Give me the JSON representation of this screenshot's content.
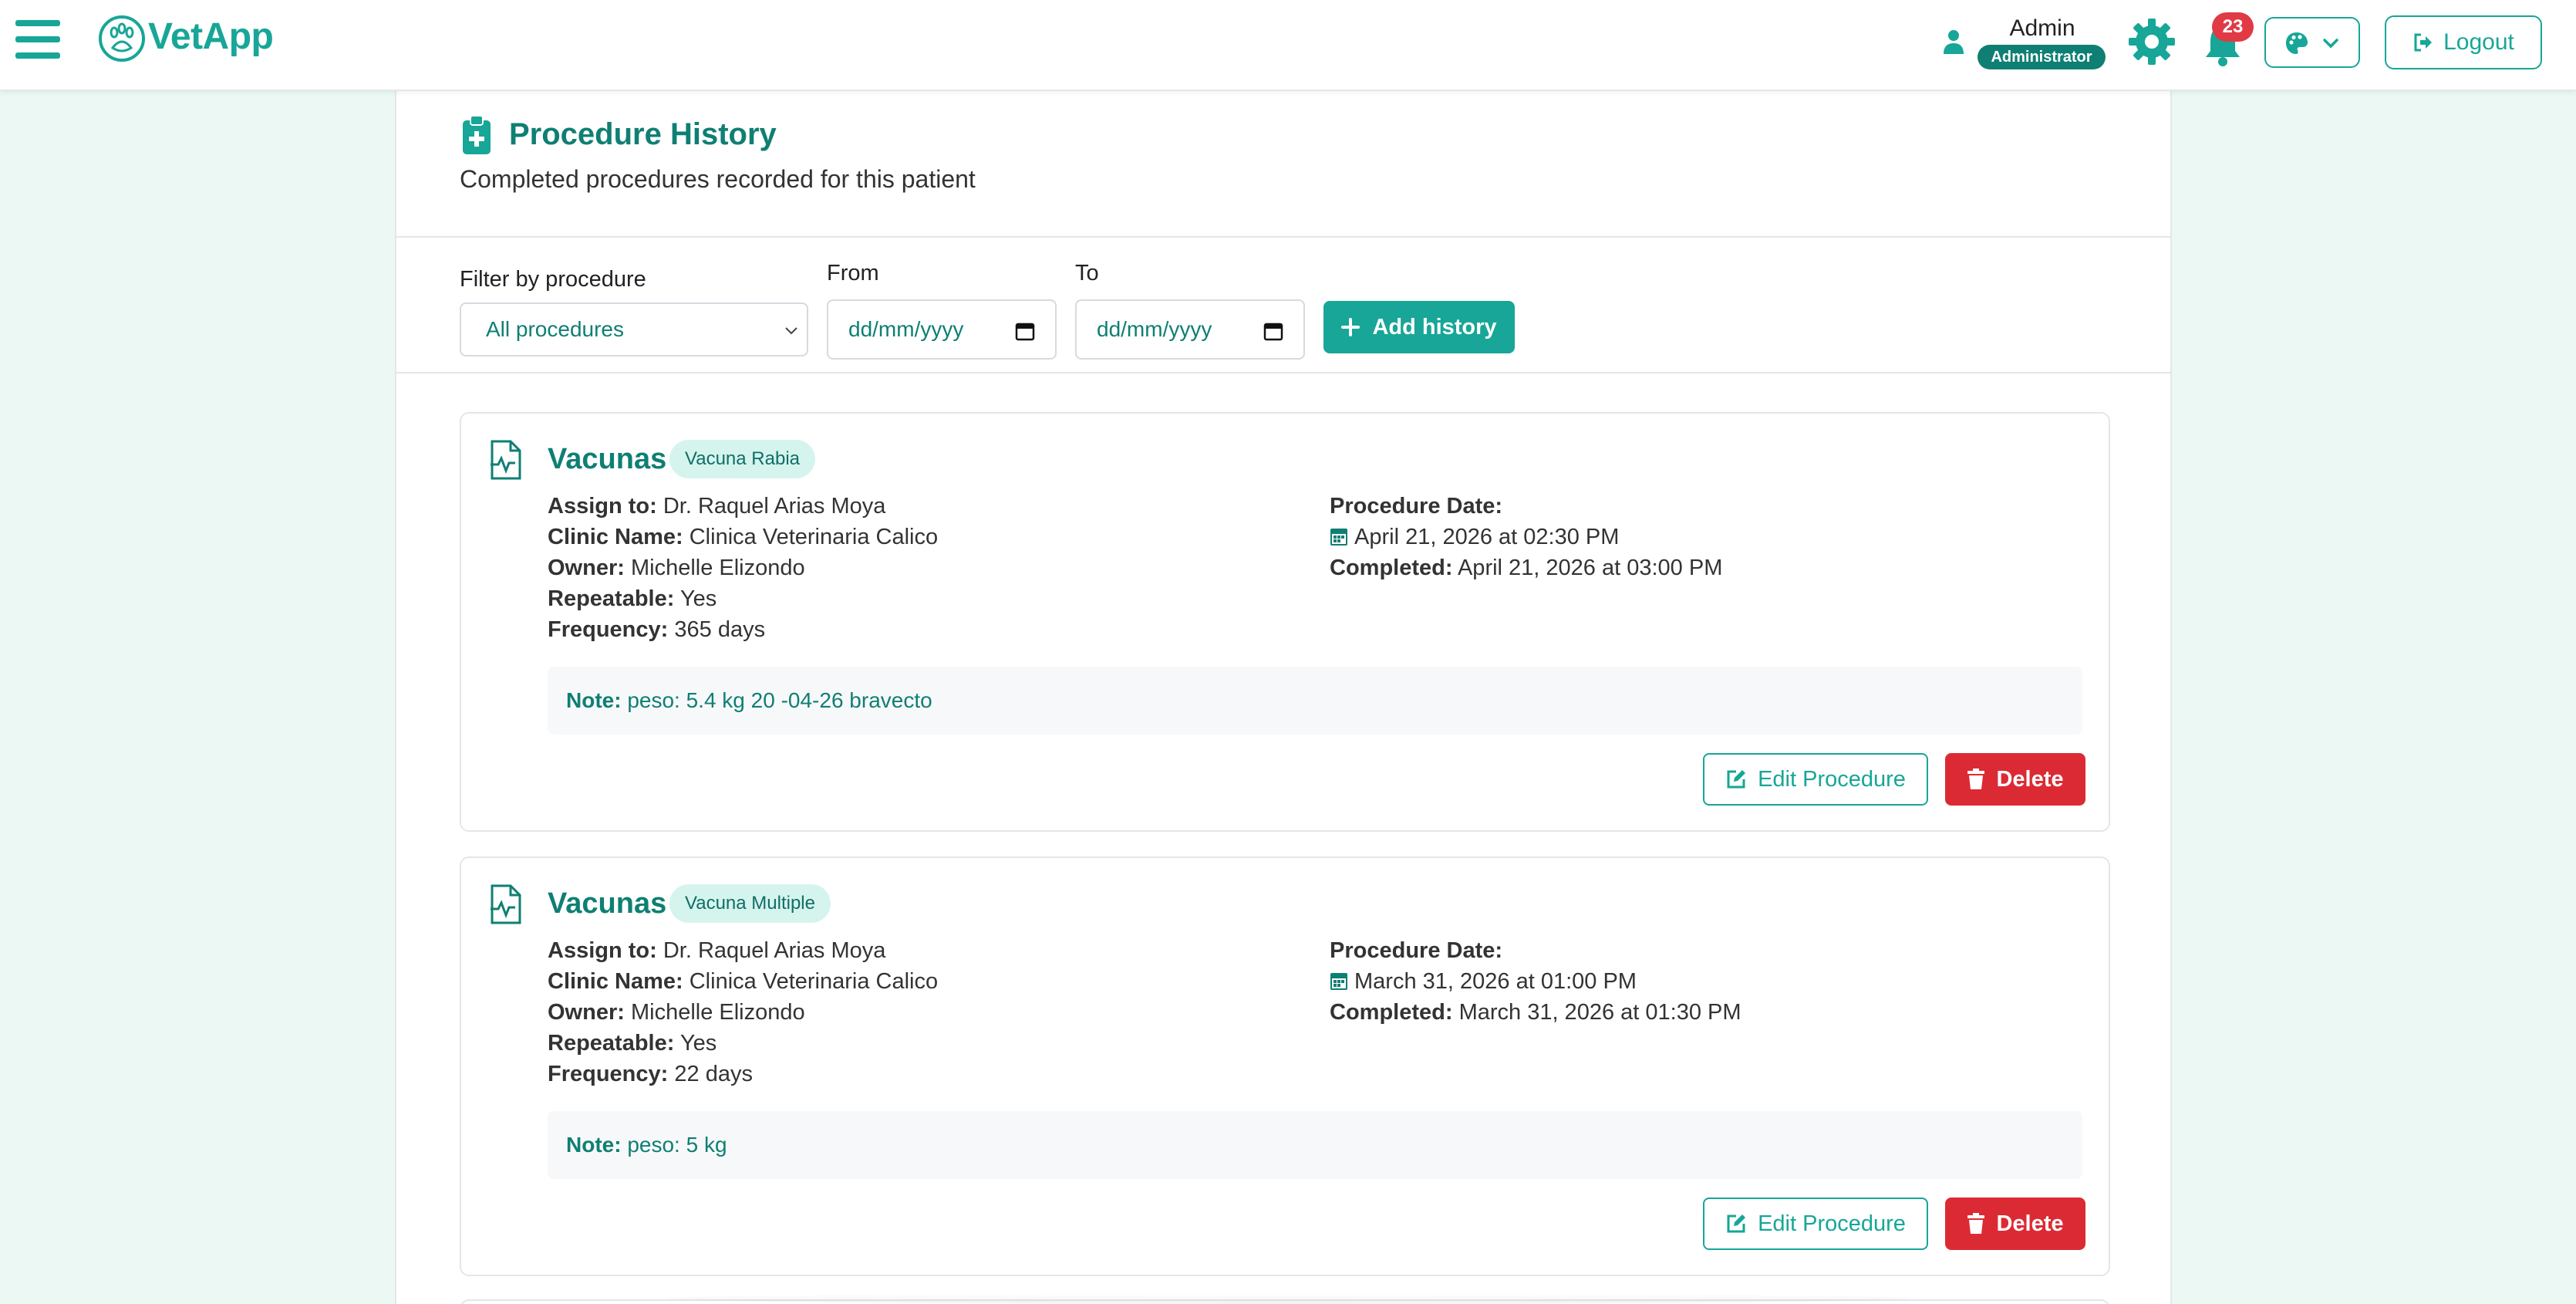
{
  "app": {
    "name": "VetApp"
  },
  "user": {
    "name": "Admin",
    "role": "Administrator"
  },
  "notifications": {
    "count": "23"
  },
  "nav": {
    "logout_label": "Logout"
  },
  "page": {
    "title": "Procedure History",
    "subtitle": "Completed procedures recorded for this patient"
  },
  "filters": {
    "procedure_label": "Filter by procedure",
    "procedure_value": "All procedures",
    "from_label": "From",
    "from_placeholder": "dd/mm/yyyy",
    "to_label": "To",
    "to_placeholder": "dd/mm/yyyy",
    "add_label": "Add history"
  },
  "labels": {
    "assign": "Assign to:",
    "clinic": "Clinic Name:",
    "owner": "Owner:",
    "repeatable": "Repeatable:",
    "frequency": "Frequency:",
    "procedure_date": "Procedure Date:",
    "completed": "Completed:",
    "note": "Note:",
    "edit": "Edit Procedure",
    "delete": "Delete"
  },
  "procedures": [
    {
      "name": "Vacunas",
      "tag": "Vacuna Rabia",
      "assign_to": "Dr. Raquel Arias Moya",
      "clinic": "Clinica Veterinaria Calico",
      "owner": "Michelle Elizondo",
      "repeatable": "Yes",
      "frequency": "365 days",
      "procedure_date": "April 21, 2026 at 02:30 PM",
      "completed": "April 21, 2026 at 03:00 PM",
      "note": "peso: 5.4 kg 20 -04-26 bravecto"
    },
    {
      "name": "Vacunas",
      "tag": "Vacuna Multiple",
      "assign_to": "Dr. Raquel Arias Moya",
      "clinic": "Clinica Veterinaria Calico",
      "owner": "Michelle Elizondo",
      "repeatable": "Yes",
      "frequency": "22 days",
      "procedure_date": "March 31, 2026 at 01:00 PM",
      "completed": "March 31, 2026 at 01:30 PM",
      "note": "peso: 5 kg"
    }
  ],
  "colors": {
    "brand": "#17a697",
    "brand_dark": "#0f7f73",
    "danger": "#dc2a34",
    "badge_red": "#e03a45",
    "page_bg": "#ebf8f4"
  },
  "icons": {
    "menu": "hamburger-menu-icon",
    "logo": "paw-logo-icon",
    "user": "user-icon",
    "settings": "gear-icon",
    "notifications": "bell-icon",
    "theme": "palette-icon",
    "logout": "logout-icon",
    "section": "clipboard-medical-icon",
    "procedure": "file-medical-icon",
    "date": "calendar-icon",
    "add": "plus-icon",
    "edit": "edit-icon",
    "delete": "trash-icon"
  }
}
